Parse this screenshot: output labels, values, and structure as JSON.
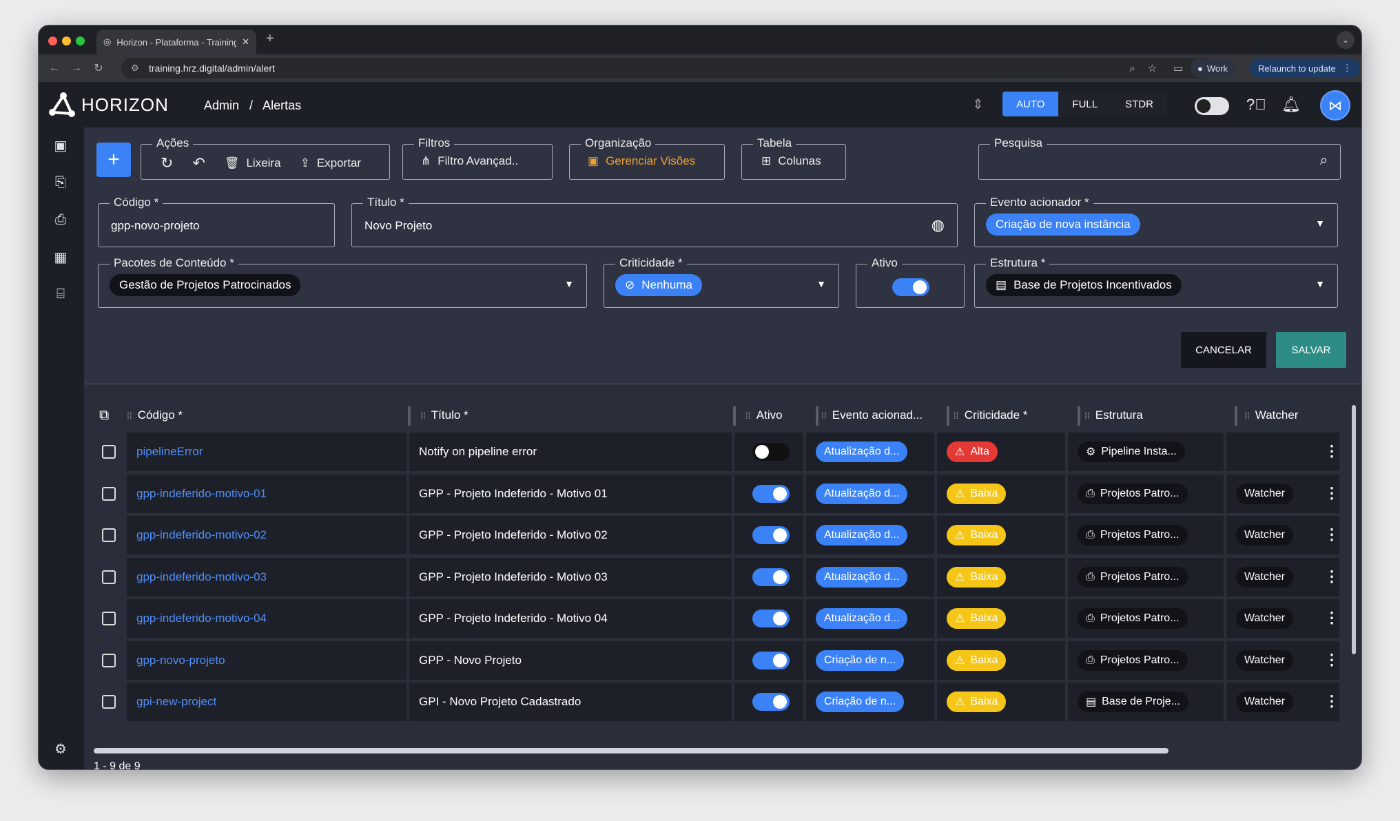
{
  "browser": {
    "tab_title": "Horizon - Plataforma - Training",
    "url": "training.hrz.digital/admin/alert",
    "profile_label": "Work",
    "relaunch_label": "Relaunch to update"
  },
  "header": {
    "logo_text": "HORIZON",
    "breadcrumb": [
      "Admin",
      "/",
      "Alertas"
    ],
    "modes": [
      "AUTO",
      "FULL",
      "STDR"
    ],
    "active_mode": "AUTO"
  },
  "toolbar": {
    "acoes_label": "Ações",
    "lixeira_label": "Lixeira",
    "exportar_label": "Exportar",
    "filtros_label": "Filtros",
    "filtro_avancado_label": "Filtro Avançad..",
    "organizacao_label": "Organização",
    "gerenciar_visoes_label": "Gerenciar Visões",
    "tabela_label": "Tabela",
    "colunas_label": "Colunas",
    "pesquisa_label": "Pesquisa"
  },
  "form": {
    "codigo_label": "Código *",
    "codigo_value": "gpp-novo-projeto",
    "titulo_label": "Título *",
    "titulo_value": "Novo Projeto",
    "evento_label": "Evento acionador *",
    "evento_value": "Criação de nova instância",
    "pacotes_label": "Pacotes de Conteúdo *",
    "pacotes_value": "Gestão de Projetos Patrocinados",
    "criticidade_label": "Criticidade *",
    "criticidade_value": "Nenhuma",
    "ativo_label": "Ativo",
    "estrutura_label": "Estrutura *",
    "estrutura_value": "Base de Projetos Incentivados",
    "cancel_label": "CANCELAR",
    "save_label": "SALVAR"
  },
  "table": {
    "columns": [
      "Código *",
      "Título *",
      "Ativo",
      "Evento acionad...",
      "Criticidade *",
      "Estrutura",
      "Watcher"
    ],
    "rows": [
      {
        "codigo": "pipelineError",
        "titulo": "Notify on pipeline error",
        "ativo": false,
        "evento": "Atualização d...",
        "criticidade": "Alta",
        "estrutura": "Pipeline Insta...",
        "watcher": ""
      },
      {
        "codigo": "gpp-indeferido-motivo-01",
        "titulo": "GPP - Projeto Indeferido - Motivo 01",
        "ativo": true,
        "evento": "Atualização d...",
        "criticidade": "Baixa",
        "estrutura": "Projetos Patro...",
        "watcher": "Watcher"
      },
      {
        "codigo": "gpp-indeferido-motivo-02",
        "titulo": "GPP - Projeto Indeferido - Motivo 02",
        "ativo": true,
        "evento": "Atualização d...",
        "criticidade": "Baixa",
        "estrutura": "Projetos Patro...",
        "watcher": "Watcher"
      },
      {
        "codigo": "gpp-indeferido-motivo-03",
        "titulo": "GPP - Projeto Indeferido - Motivo 03",
        "ativo": true,
        "evento": "Atualização d...",
        "criticidade": "Baixa",
        "estrutura": "Projetos Patro...",
        "watcher": "Watcher"
      },
      {
        "codigo": "gpp-indeferido-motivo-04",
        "titulo": "GPP - Projeto Indeferido - Motivo 04",
        "ativo": true,
        "evento": "Atualização d...",
        "criticidade": "Baixa",
        "estrutura": "Projetos Patro...",
        "watcher": "Watcher"
      },
      {
        "codigo": "gpp-novo-projeto",
        "titulo": "GPP - Novo Projeto",
        "ativo": true,
        "evento": "Criação de n...",
        "criticidade": "Baixa",
        "estrutura": "Projetos Patro...",
        "watcher": "Watcher"
      },
      {
        "codigo": "gpi-new-project",
        "titulo": "GPI - Novo Projeto Cadastrado",
        "ativo": true,
        "evento": "Criação de n...",
        "criticidade": "Baixa",
        "estrutura": "Base de Proje...",
        "watcher": "Watcher"
      }
    ],
    "pager": "1 - 9 de 9"
  },
  "colors": {
    "accent": "#3b82f6",
    "save": "#2d8c85",
    "alta": "#e53935",
    "baixa": "#f5c518",
    "link": "#4f8ff7",
    "highlight": "#f0a030"
  }
}
